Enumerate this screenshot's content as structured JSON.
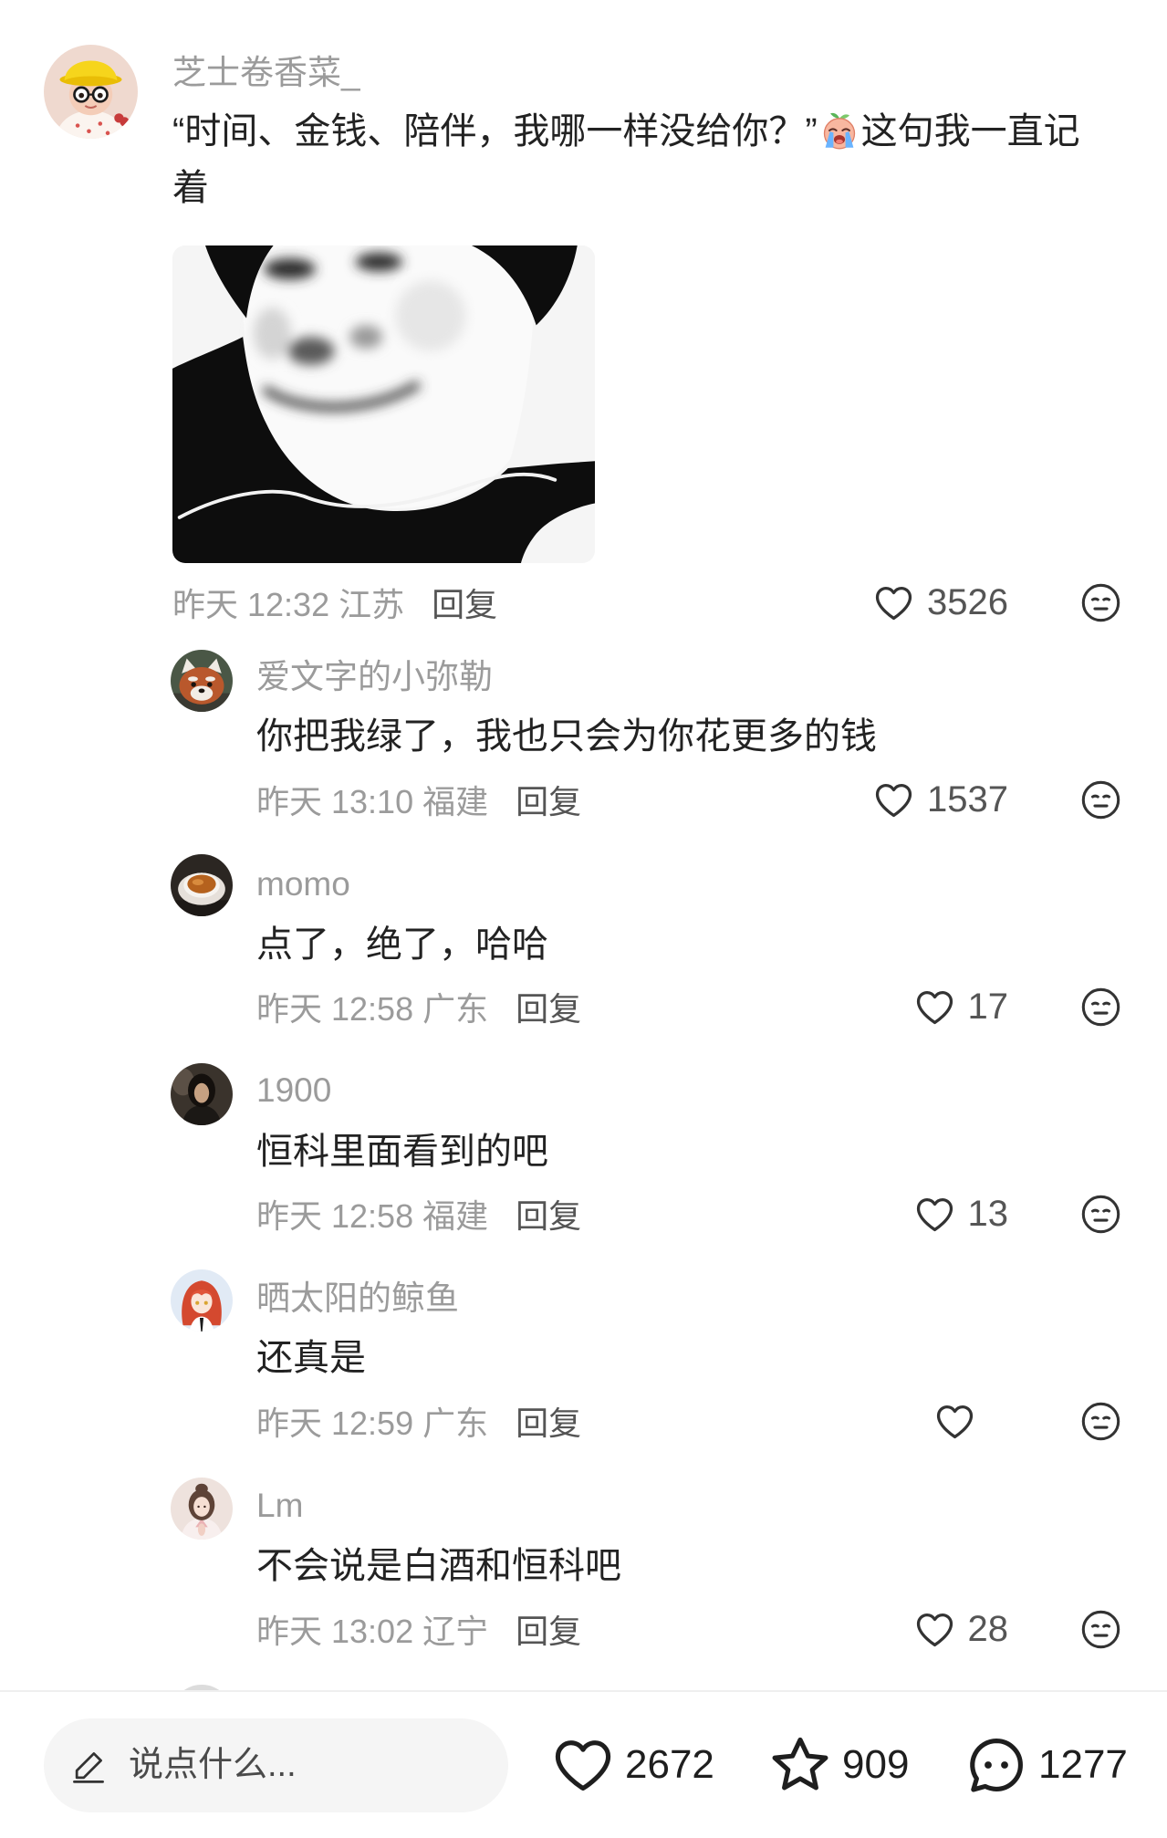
{
  "main_comment": {
    "username": "芝士卷香菜_",
    "text_before_emoji": "“时间、金钱、陪伴，我哪一样没给你？”",
    "emoji": "crying-face-emoji",
    "text_after_emoji": "这句我一直记着",
    "meta": "昨天 12:32 江苏",
    "reply_label": "回复",
    "likes": "3526"
  },
  "replies": [
    {
      "username": "爱文字的小弥勒",
      "text": "你把我绿了，我也只会为你花更多的钱",
      "meta": "昨天 13:10 福建",
      "reply_label": "回复",
      "likes": "1537"
    },
    {
      "username": "momo",
      "text": "点了，绝了，哈哈",
      "meta": "昨天 12:58 广东",
      "reply_label": "回复",
      "likes": "17"
    },
    {
      "username": "1900",
      "text": "恒科里面看到的吧",
      "meta": "昨天 12:58 福建",
      "reply_label": "回复",
      "likes": "13"
    },
    {
      "username": "晒太阳的鲸鱼",
      "text": "还真是",
      "meta": "昨天 12:59 广东",
      "reply_label": "回复"
    },
    {
      "username": "Lm",
      "text": "不会说是白酒和恒科吧",
      "meta": "昨天 13:02 辽宁",
      "reply_label": "回复",
      "likes": "28"
    }
  ],
  "bottom_bar": {
    "input_placeholder": "说点什么...",
    "likes": "2672",
    "favorites": "909",
    "comments": "1277"
  },
  "icons": {
    "like": "heart-icon",
    "dislike": "dislike-face-icon",
    "edit": "pencil-icon",
    "favorite": "star-icon",
    "comment": "comment-bubble-icon"
  },
  "colors": {
    "username": "#9b9b9b",
    "comment_text": "#222222",
    "meta": "#9b9b9b",
    "reply_link": "#555555",
    "icon": "#333333",
    "input_background": "#f5f5f5",
    "divider": "#efefef"
  }
}
